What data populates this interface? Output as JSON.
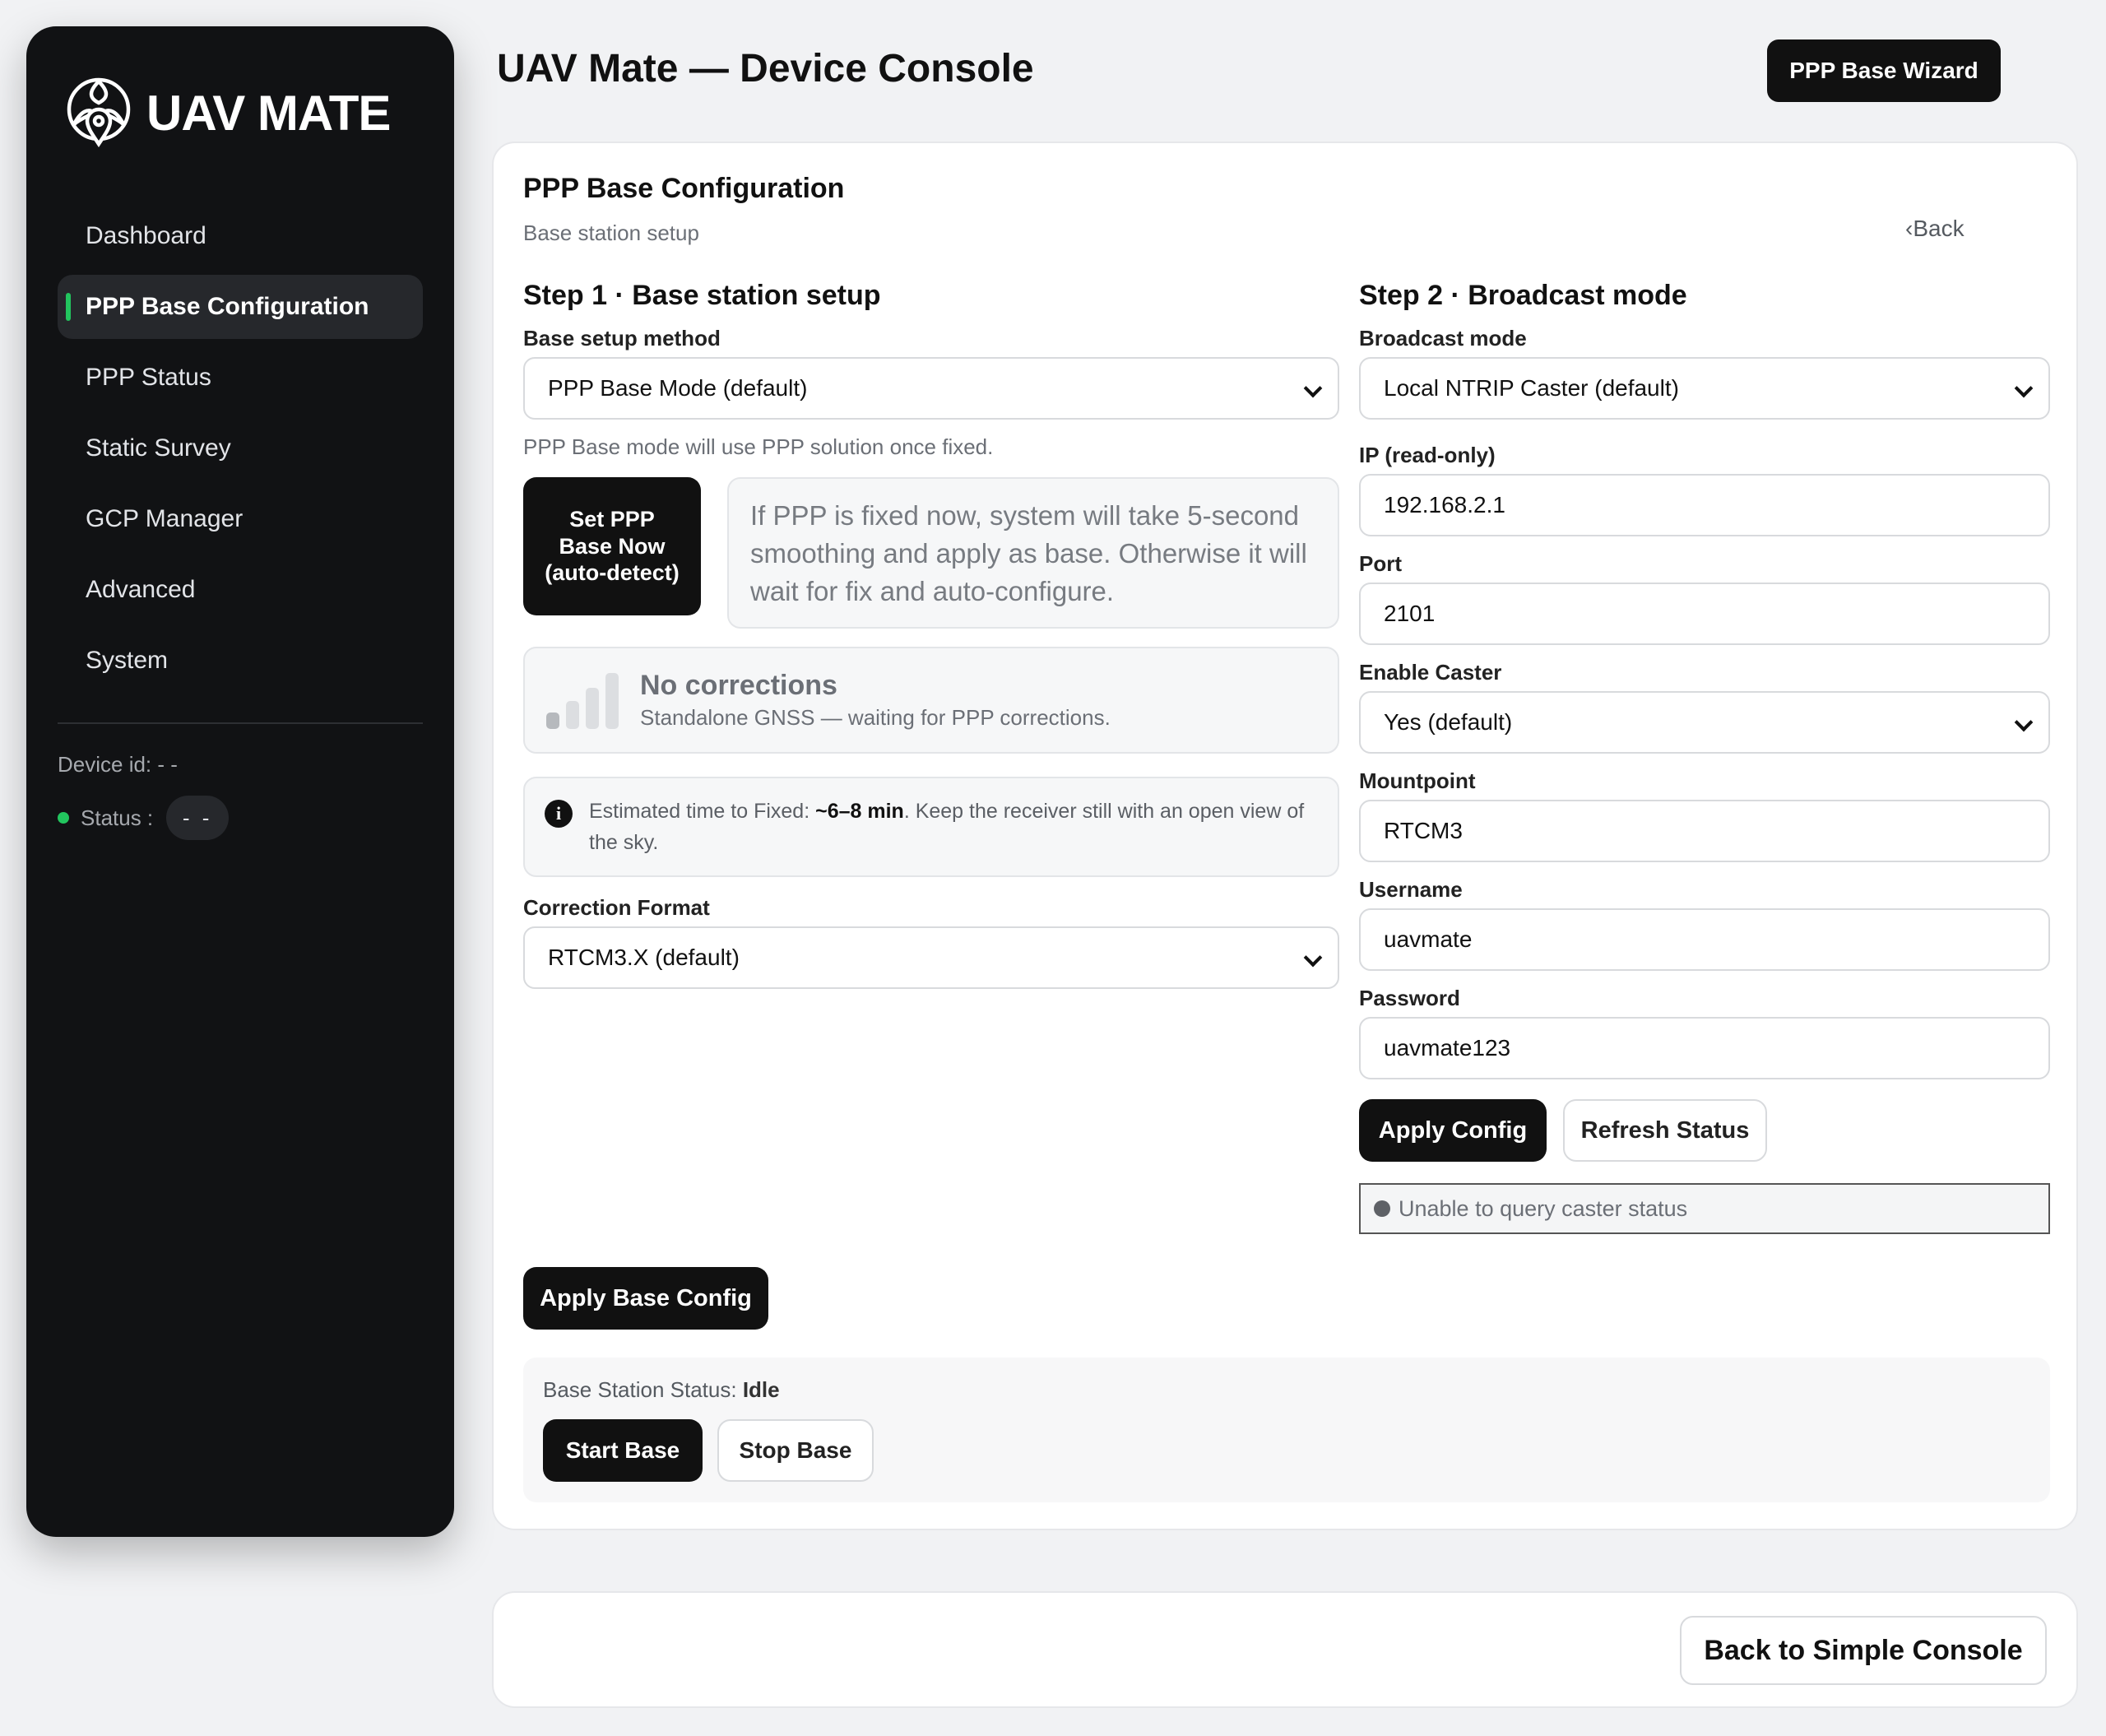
{
  "brand": {
    "name": "UAV MATE",
    "logo_icon": "drone-location-icon"
  },
  "sidebar": {
    "items": [
      {
        "label": "Dashboard",
        "active": false
      },
      {
        "label": "PPP Base Configuration",
        "active": true
      },
      {
        "label": "PPP Status",
        "active": false
      },
      {
        "label": "Static Survey",
        "active": false
      },
      {
        "label": "GCP Manager",
        "active": false
      },
      {
        "label": "Advanced",
        "active": false
      },
      {
        "label": "System",
        "active": false
      }
    ],
    "device_id": "Device id: - -",
    "status_label": "Status  :",
    "status_value": "- -"
  },
  "header": {
    "title": "UAV Mate — Device Console",
    "wizard_button": "PPP Base Wizard"
  },
  "card": {
    "title": "PPP Base Configuration",
    "subtitle": "Base station setup",
    "back_link": "Back"
  },
  "step1": {
    "title": "Step 1 · Base station setup",
    "method_label": "Base setup method",
    "method_value": "PPP Base Mode (default)",
    "method_hint": "PPP Base mode will use PPP solution once fixed.",
    "set_ppp_button": "Set PPP Base Now (auto-detect)",
    "set_ppp_info": "If PPP is fixed now, system will take 5-second smoothing and apply as base. Otherwise it will wait for fix and auto-configure.",
    "corrections_title": "No corrections",
    "corrections_sub": "Standalone GNSS — waiting for PPP corrections.",
    "est_prefix": "Estimated time to Fixed: ",
    "est_value": "~6–8 min",
    "est_suffix": ". Keep the receiver still with an open view of the sky.",
    "format_label": "Correction Format",
    "format_value": "RTCM3.X (default)"
  },
  "step2": {
    "title": "Step 2 · Broadcast mode",
    "mode_label": "Broadcast mode",
    "mode_value": "Local NTRIP Caster (default)",
    "ip_label": "IP (read-only)",
    "ip_value": "192.168.2.1",
    "port_label": "Port",
    "port_value": "2101",
    "caster_label": "Enable Caster",
    "caster_value": "Yes (default)",
    "mount_label": "Mountpoint",
    "mount_value": "RTCM3",
    "user_label": "Username",
    "user_value": "uavmate",
    "pass_label": "Password",
    "pass_value": "uavmate123",
    "apply_button": "Apply Config",
    "refresh_button": "Refresh Status",
    "caster_status": "Unable to query caster status"
  },
  "base": {
    "apply_button": "Apply Base Config",
    "status_prefix": "Base Station Status: ",
    "status_value": "Idle",
    "start_button": "Start Base",
    "stop_button": "Stop Base"
  },
  "footer": {
    "simple_console_button": "Back to Simple Console"
  },
  "colors": {
    "accent_green": "#22c55e",
    "dark": "#111214"
  }
}
